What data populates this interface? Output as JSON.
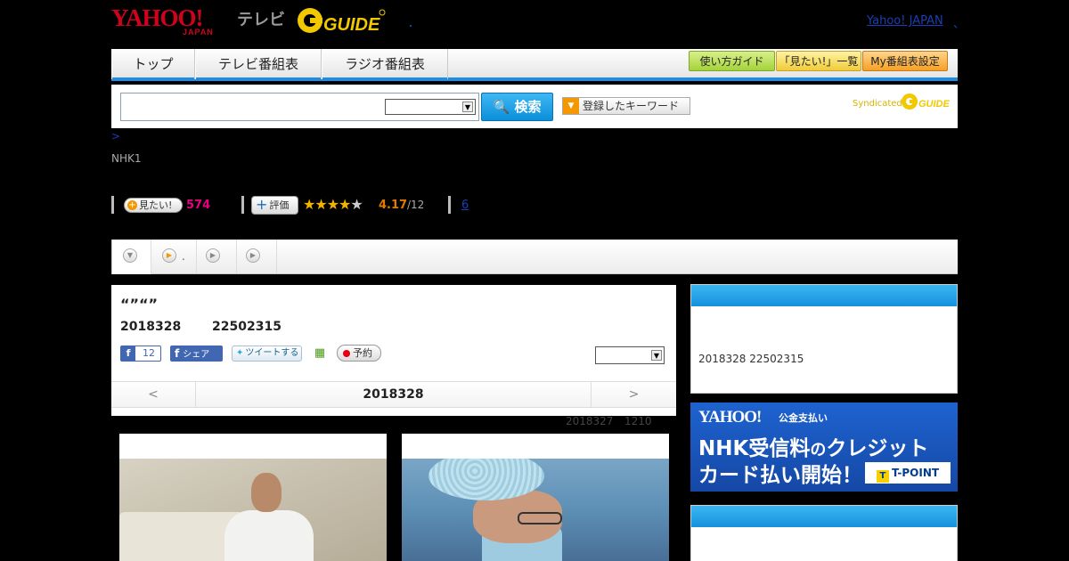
{
  "header": {
    "logo_yahoo": "YAHOO!",
    "logo_japan": "JAPAN",
    "logo_tv": "テレビ",
    "logo_gguide": "GUIDE",
    "yahoo_japan_link": "Yahoo! JAPAN",
    "yahoo_japan_link_suffix": "、"
  },
  "nav": {
    "tabs": [
      "トップ",
      "テレビ番組表",
      "ラジオ番組表"
    ],
    "buttons": [
      {
        "label": "使い方ガイド",
        "color": "#a4d23a"
      },
      {
        "label": "「見たい!」一覧",
        "color": "#f1cc3a"
      },
      {
        "label": "My番組表設定",
        "color": "#f5a025"
      }
    ],
    "accent": "#1d8ee6"
  },
  "search": {
    "placeholder": "",
    "select_value": "",
    "button_label": "検索",
    "keyword_button": "登録したキーワード",
    "syndicated": "Syndicated"
  },
  "breadcrumb": ">",
  "channel": "NHK1",
  "stats": {
    "mitai_label": "見たい!",
    "mitai_count": "574",
    "hyoka_label": "評価",
    "stars_filled": 4,
    "stars_total": 5,
    "rating": "4.17",
    "rating_count": "/12",
    "review_count": "6"
  },
  "tabs_bar": {
    "tab2_label": "."
  },
  "program": {
    "title": "“”“”",
    "date": "2018328",
    "time": "22502315",
    "fb_like_count": "12",
    "fb_share": "シェア",
    "tweet": "ツイートする",
    "reserve": "予約",
    "select_value": "",
    "day_prev": "<",
    "day_current": "2018328",
    "day_next": ">"
  },
  "updated": {
    "date": "2018327",
    "time": "1210"
  },
  "sidebar": {
    "box1_text": "2018328  22502315",
    "ad": {
      "yahoo": "YAHOO!",
      "kokin": "公金支払い",
      "line1_a": "NHK受信料",
      "line1_b": "の",
      "line1_c": "クレジット",
      "line2": "カード払い開始！",
      "tpoint": "T-POINT"
    }
  },
  "colors": {
    "search_button": "#0a8fdb",
    "sidebar_header": "#1591dd",
    "mitai_count": "#e4007f",
    "rating": "#e07b00",
    "star_on": "#f3b400"
  }
}
